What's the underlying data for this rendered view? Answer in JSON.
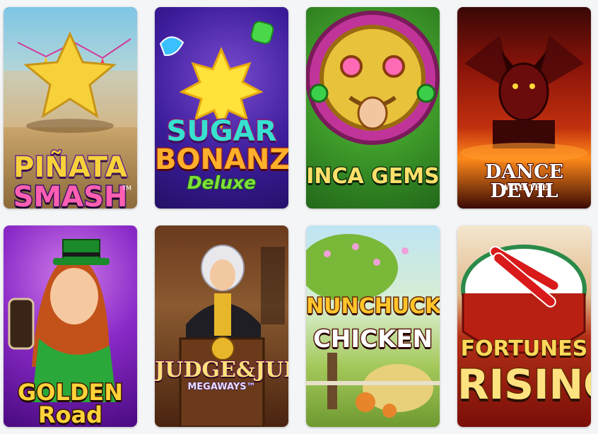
{
  "games": [
    {
      "id": "pinata-smash",
      "title_lines": [
        "PIÑATA",
        "SMASH"
      ],
      "trademark": "TM"
    },
    {
      "id": "sugar-bonanza-deluxe",
      "title_lines": [
        "SUGAR",
        "BONANZA",
        "Deluxe"
      ]
    },
    {
      "id": "inca-gems",
      "title_lines": [
        "INCA GEMS"
      ]
    },
    {
      "id": "dance-with-the-devil",
      "title_lines": [
        "DANCE   DEVIL",
        "WITH THE"
      ]
    },
    {
      "id": "golden-road",
      "title_lines": [
        "GOLDEN Road"
      ]
    },
    {
      "id": "judge-and-jury",
      "title_lines": [
        "JUDGE&JURY",
        "MEGAWAYS™"
      ]
    },
    {
      "id": "nunchucks-chicken",
      "title_lines": [
        "NUNCHUCKS",
        "CHICKEN"
      ]
    },
    {
      "id": "fortunes-rising",
      "title_lines": [
        "FORTUNES",
        "RISING"
      ]
    }
  ]
}
